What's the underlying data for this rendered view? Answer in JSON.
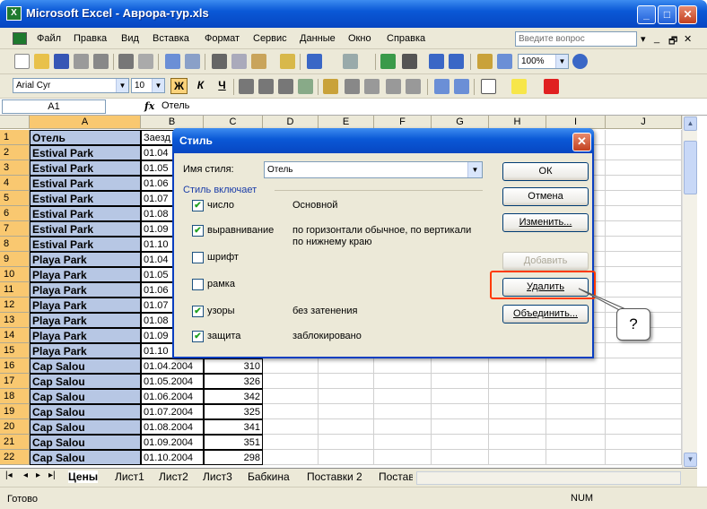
{
  "window": {
    "title": "Microsoft Excel - Аврора-тур.xls",
    "app_icon": "X",
    "min": "_",
    "max": "□",
    "close": "✕"
  },
  "menu": {
    "items": [
      "Файл",
      "Правка",
      "Вид",
      "Вставка",
      "Формат",
      "Сервис",
      "Данные",
      "Окно",
      "Справка"
    ],
    "help_placeholder": "Введите вопрос",
    "controls": [
      "▾",
      "_",
      "🗗",
      "✕"
    ]
  },
  "toolbar": {
    "zoom": "100%",
    "font_name": "Arial Cyr",
    "font_size": "10",
    "bold": "Ж",
    "italic": "К",
    "underline": "Ч"
  },
  "formula": {
    "cell_ref": "A1",
    "fx": "fx",
    "content": "Отель"
  },
  "columns": [
    "A",
    "B",
    "C",
    "D",
    "E",
    "F",
    "G",
    "H",
    "I",
    "J"
  ],
  "rows": [
    {
      "n": "1",
      "a": "Отель",
      "b": "Заезд",
      "c": ""
    },
    {
      "n": "2",
      "a": "Estival Park",
      "b": "01.04",
      "c": ""
    },
    {
      "n": "3",
      "a": "Estival Park",
      "b": "01.05",
      "c": ""
    },
    {
      "n": "4",
      "a": "Estival Park",
      "b": "01.06",
      "c": ""
    },
    {
      "n": "5",
      "a": "Estival Park",
      "b": "01.07",
      "c": ""
    },
    {
      "n": "6",
      "a": "Estival Park",
      "b": "01.08",
      "c": ""
    },
    {
      "n": "7",
      "a": "Estival Park",
      "b": "01.09",
      "c": ""
    },
    {
      "n": "8",
      "a": "Estival Park",
      "b": "01.10",
      "c": ""
    },
    {
      "n": "9",
      "a": "Playa Park",
      "b": "01.04",
      "c": ""
    },
    {
      "n": "10",
      "a": "Playa Park",
      "b": "01.05",
      "c": ""
    },
    {
      "n": "11",
      "a": "Playa Park",
      "b": "01.06",
      "c": ""
    },
    {
      "n": "12",
      "a": "Playa Park",
      "b": "01.07",
      "c": ""
    },
    {
      "n": "13",
      "a": "Playa Park",
      "b": "01.08",
      "c": ""
    },
    {
      "n": "14",
      "a": "Playa Park",
      "b": "01.09",
      "c": ""
    },
    {
      "n": "15",
      "a": "Playa Park",
      "b": "01.10",
      "c": ""
    },
    {
      "n": "16",
      "a": "Cap Salou",
      "b": "01.04.2004",
      "c": "310"
    },
    {
      "n": "17",
      "a": "Cap Salou",
      "b": "01.05.2004",
      "c": "326"
    },
    {
      "n": "18",
      "a": "Cap Salou",
      "b": "01.06.2004",
      "c": "342"
    },
    {
      "n": "19",
      "a": "Cap Salou",
      "b": "01.07.2004",
      "c": "325"
    },
    {
      "n": "20",
      "a": "Cap Salou",
      "b": "01.08.2004",
      "c": "341"
    },
    {
      "n": "21",
      "a": "Cap Salou",
      "b": "01.09.2004",
      "c": "351"
    },
    {
      "n": "22",
      "a": "Cap Salou",
      "b": "01.10.2004",
      "c": "298"
    }
  ],
  "tabs": {
    "nav": [
      "|◂",
      "◂",
      "▸",
      "▸|"
    ],
    "sheets": [
      "Цены",
      "Лист1",
      "Лист2",
      "Лист3",
      "Бабкина",
      "Поставки 2",
      "Постав"
    ],
    "active": 0
  },
  "status": {
    "ready": "Готово",
    "num": "NUM"
  },
  "dialog": {
    "title": "Стиль",
    "close": "✕",
    "style_name_label": "Имя стиля:",
    "style_name_value": "Отель",
    "includes_label": "Стиль включает",
    "options": [
      {
        "label": "число",
        "checked": true,
        "desc": "Основной"
      },
      {
        "label": "выравнивание",
        "checked": true,
        "desc": "по горизонтали обычное, по вертикали по нижнему краю"
      },
      {
        "label": "шрифт",
        "checked": false,
        "desc": ""
      },
      {
        "label": "рамка",
        "checked": false,
        "desc": ""
      },
      {
        "label": "узоры",
        "checked": true,
        "desc": "без затенения"
      },
      {
        "label": "защита",
        "checked": true,
        "desc": "заблокировано"
      }
    ],
    "buttons": {
      "ok": "ОК",
      "cancel": "Отмена",
      "modify": "Изменить...",
      "add": "Добавить",
      "delete": "Удалить",
      "merge": "Объединить..."
    }
  },
  "callout": {
    "text": "?"
  }
}
